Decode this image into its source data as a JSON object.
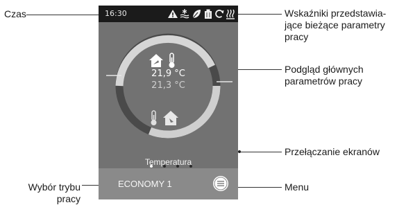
{
  "screen": {
    "time": "16:30",
    "indoor_temp": "21,9 °C",
    "outdoor_temp": "21,3 °C",
    "screen_label": "Temperatura",
    "page_count": 4,
    "active_page": 1,
    "mode": "ECONOMY 1"
  },
  "callouts": {
    "time": "Czas",
    "indicators": [
      "Wskaźniki przedstawia-",
      "jące bieżące parametry",
      "pracy"
    ],
    "preview": [
      "Podgląd głównych",
      "parametrów pracy"
    ],
    "switch": "Przełączanie ekranów",
    "mode": [
      "Wybór trybu",
      "pracy"
    ],
    "menu": "Menu"
  },
  "icons": {
    "status": [
      "warning-icon",
      "defrost-icon",
      "leaf-icon",
      "filter-icon",
      "refresh-icon",
      "heater-icon"
    ],
    "indoor": [
      "house-icon",
      "thermometer-icon"
    ],
    "outdoor": [
      "thermometer-icon",
      "house-icon"
    ],
    "nav": [
      "chevron-left-icon",
      "chevron-right-icon"
    ],
    "menu": "menu-icon"
  },
  "colors": {
    "screen_bg": "#727272",
    "status_bar": "#1b1b1b",
    "mode_bar": "#8a8a8a",
    "ring_light": "#d4d4d4",
    "ring_dark": "#4a4a4a",
    "indoor_text": "#ffffff",
    "outdoor_text": "#cfcfcf"
  }
}
